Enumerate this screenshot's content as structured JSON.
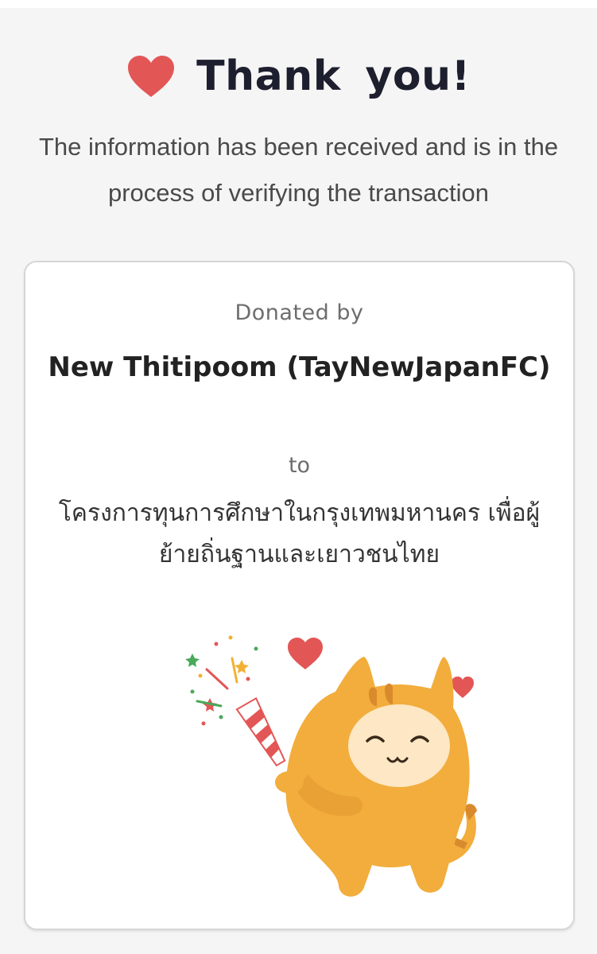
{
  "header": {
    "icon": "heart-icon",
    "title": "Thank  you!"
  },
  "subtitle": "The information has been received and is in the process of verifying the transaction",
  "card": {
    "donated_label": "Donated  by",
    "donor_name": "New Thitipoom (TayNewJapanFC)",
    "to_label": "to",
    "project_name": "โครงการทุนการศึกษาในกรุงเทพมหานคร เพื่อผู้ย้ายถิ่นฐานและเยาวชนไทย",
    "illustration": "celebrating-cat-mascot"
  },
  "colors": {
    "heart": "#e35656",
    "mascot_body": "#f2ad3c",
    "mascot_face": "#fde7c4",
    "background": "#f5f5f5"
  }
}
